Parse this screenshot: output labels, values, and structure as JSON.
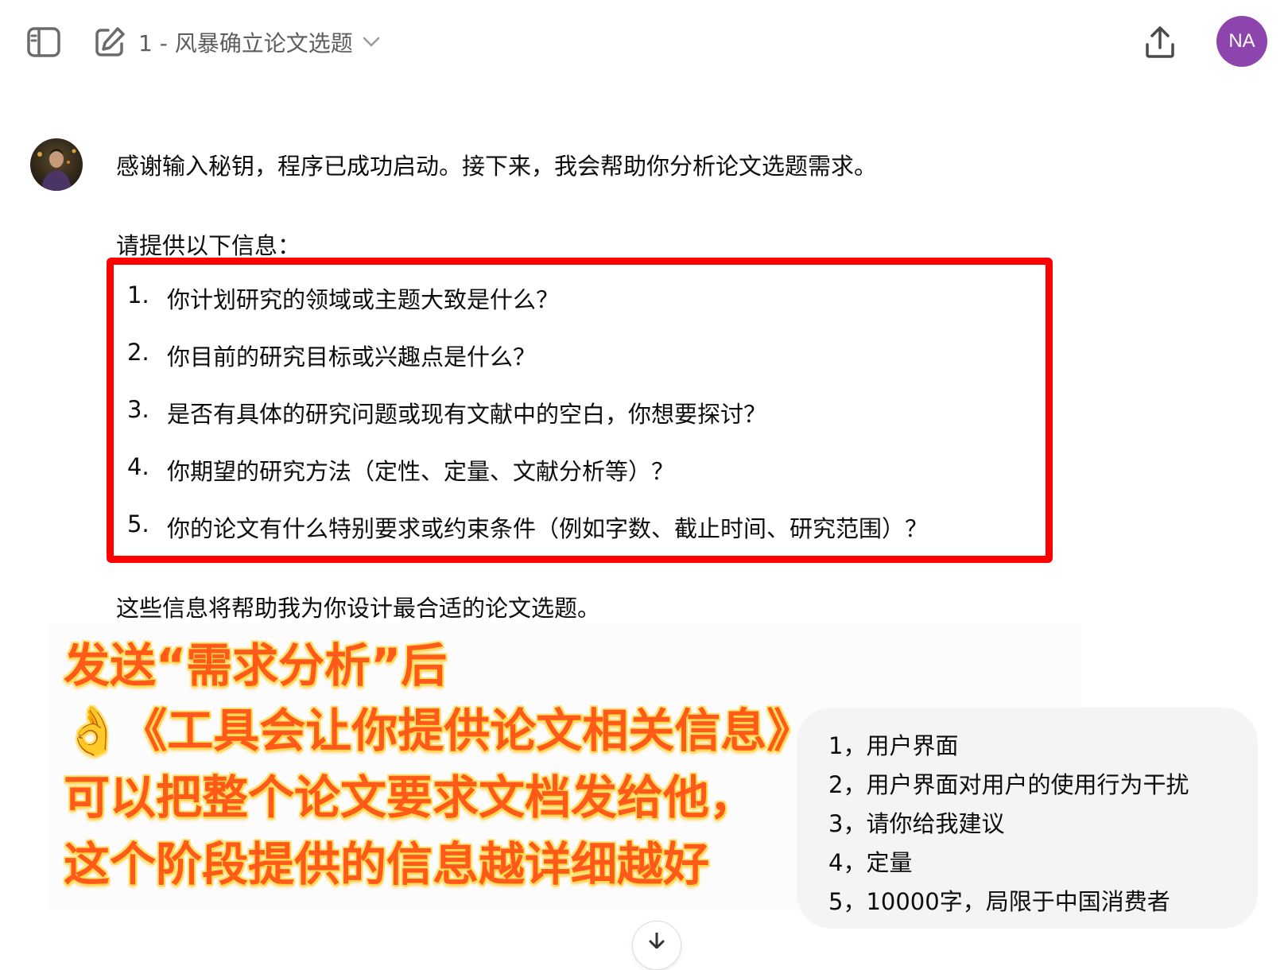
{
  "header": {
    "chat_title": "1 - 风暴确立论文选题",
    "user_initials": "NA",
    "colors": {
      "avatar": "#8e44ad"
    }
  },
  "assistant": {
    "line1": "感谢输入秘钥，程序已成功启动。接下来，我会帮助你分析论文选题需求。",
    "line2": "请提供以下信息：",
    "questions": [
      {
        "num": "1.",
        "text": "你计划研究的领域或主题大致是什么？"
      },
      {
        "num": "2.",
        "text": "你目前的研究目标或兴趣点是什么？"
      },
      {
        "num": "3.",
        "text": "是否有具体的研究问题或现有文献中的空白，你想要探讨？"
      },
      {
        "num": "4.",
        "text": "你期望的研究方法（定性、定量、文献分析等）？"
      },
      {
        "num": "5.",
        "text": "你的论文有什么特别要求或约束条件（例如字数、截止时间、研究范围）？"
      }
    ],
    "line3": "这些信息将帮助我为你设计最合适的论文选题。"
  },
  "annotation": {
    "line1": "发送“需求分析”后",
    "line2": "👌《工具会让你提供论文相关信息》",
    "line3": "可以把整个论文要求文档发给他，",
    "line4": "这个阶段提供的信息越详细越好",
    "colors": {
      "text": "#ff5a1a",
      "glow": "#ffd84a",
      "highlight_border": "#ff0000"
    }
  },
  "user_message": {
    "lines": [
      "1，用户界面",
      "2，用户界面对用户的使用行为干扰",
      "3，请你给我建议",
      "4，定量",
      "5，10000字，局限于中国消费者"
    ]
  }
}
